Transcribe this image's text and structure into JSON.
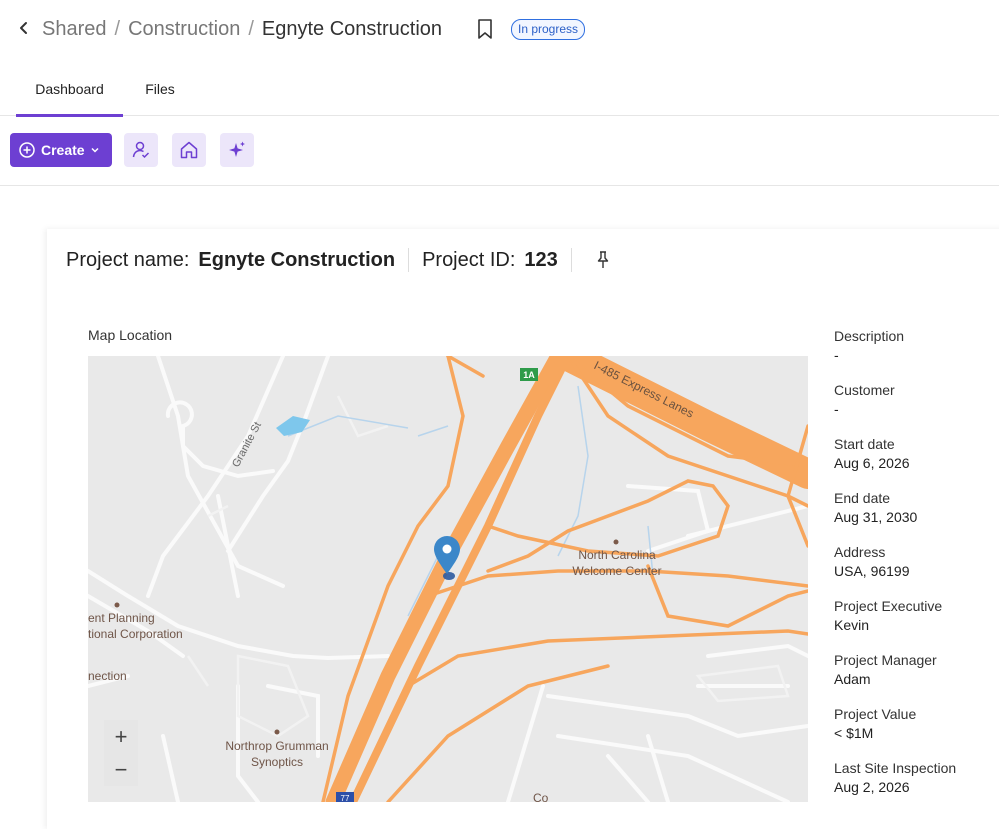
{
  "breadcrumb": {
    "items": [
      "Shared",
      "Construction"
    ],
    "current": "Egnyte Construction"
  },
  "status_badge": "In progress",
  "tabs": [
    {
      "label": "Dashboard",
      "active": true
    },
    {
      "label": "Files",
      "active": false
    }
  ],
  "toolbar": {
    "create_label": "Create",
    "icons": [
      "people-check-icon",
      "home-icon",
      "sparkle-icon"
    ]
  },
  "project": {
    "name_label": "Project name:",
    "name": "Egnyte Construction",
    "id_label": "Project ID:",
    "id": "123"
  },
  "map": {
    "label": "Map Location",
    "labels": [
      "I-485 Express Lanes",
      "Granite St",
      "North Carolina",
      "Welcome Center",
      "ent Planning",
      "tional Corporation",
      "nection",
      "Northrop Grumman",
      "Synoptics",
      "1A",
      "77",
      "Co"
    ],
    "zoom_in": "+",
    "zoom_out": "−"
  },
  "details": [
    {
      "label": "Description",
      "value": "-"
    },
    {
      "label": "Customer",
      "value": "-"
    },
    {
      "label": "Start date",
      "value": "Aug 6, 2026"
    },
    {
      "label": "End date",
      "value": "Aug 31, 2030"
    },
    {
      "label": "Address",
      "value": "USA, 96199"
    },
    {
      "label": "Project Executive",
      "value": "Kevin"
    },
    {
      "label": "Project Manager",
      "value": "Adam"
    },
    {
      "label": "Project Value",
      "value": "< $1M"
    },
    {
      "label": "Last Site Inspection",
      "value": "Aug 2, 2026"
    }
  ],
  "colors": {
    "accent": "#6d3fd2",
    "badge": "#2f6fe0",
    "highway": "#f7a65d",
    "map_bg": "#e9e9e9",
    "pin": "#3b87c9"
  }
}
